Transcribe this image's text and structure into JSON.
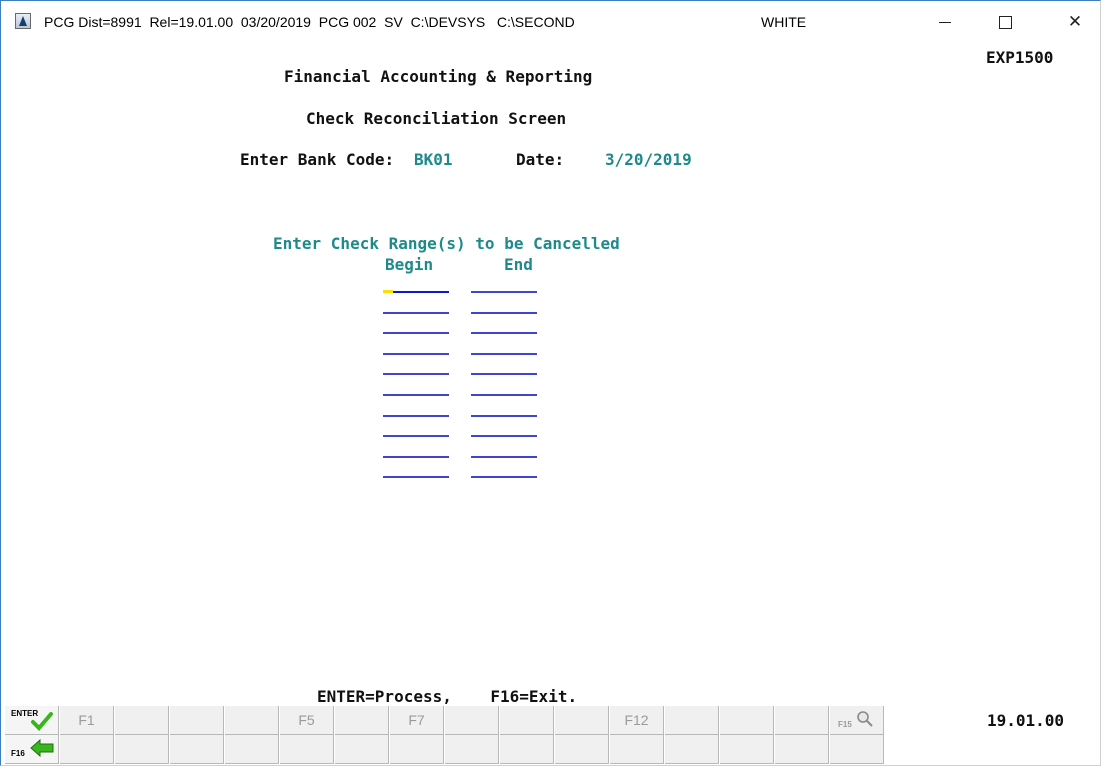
{
  "window": {
    "title": "PCG Dist=8991  Rel=19.01.00  03/20/2019  PCG 002  SV  C:\\DEVSYS   C:\\SECOND",
    "user": "WHITE"
  },
  "screen": {
    "program_id": "EXP1500",
    "heading": "Financial Accounting & Reporting",
    "subheading": "Check Reconciliation Screen",
    "bank_code_label": "Enter Bank Code:",
    "bank_code_value": "BK01",
    "date_label": "Date:",
    "date_value": "3/20/2019",
    "range_title": "Enter Check Range(s) to be Cancelled",
    "col_begin": "Begin",
    "col_end": "End",
    "range_rows": [
      {
        "begin": "",
        "end": ""
      },
      {
        "begin": "",
        "end": ""
      },
      {
        "begin": "",
        "end": ""
      },
      {
        "begin": "",
        "end": ""
      },
      {
        "begin": "",
        "end": ""
      },
      {
        "begin": "",
        "end": ""
      },
      {
        "begin": "",
        "end": ""
      },
      {
        "begin": "",
        "end": ""
      },
      {
        "begin": "",
        "end": ""
      },
      {
        "begin": "",
        "end": ""
      }
    ],
    "fkey_hint": "ENTER=Process,    F16=Exit.",
    "version": "19.01.00"
  },
  "fkeys": {
    "enter_label": "ENTER",
    "f16_label": "F16",
    "f15_label": "F15",
    "row1": [
      "",
      "F1",
      "",
      "",
      "",
      "F5",
      "",
      "F7",
      "",
      "",
      "",
      "F12",
      "",
      "",
      "",
      ""
    ],
    "row2": [
      "",
      "",
      "",
      "",
      "",
      "",
      "",
      "",
      "",
      "",
      "",
      "",
      "",
      "",
      "",
      ""
    ],
    "icons": {
      "enter": "checkmark-icon",
      "f16": "back-arrow-icon",
      "f15": "magnifier-icon"
    },
    "colors": {
      "check": "#39b51e",
      "arrow": "#39b51e"
    }
  }
}
